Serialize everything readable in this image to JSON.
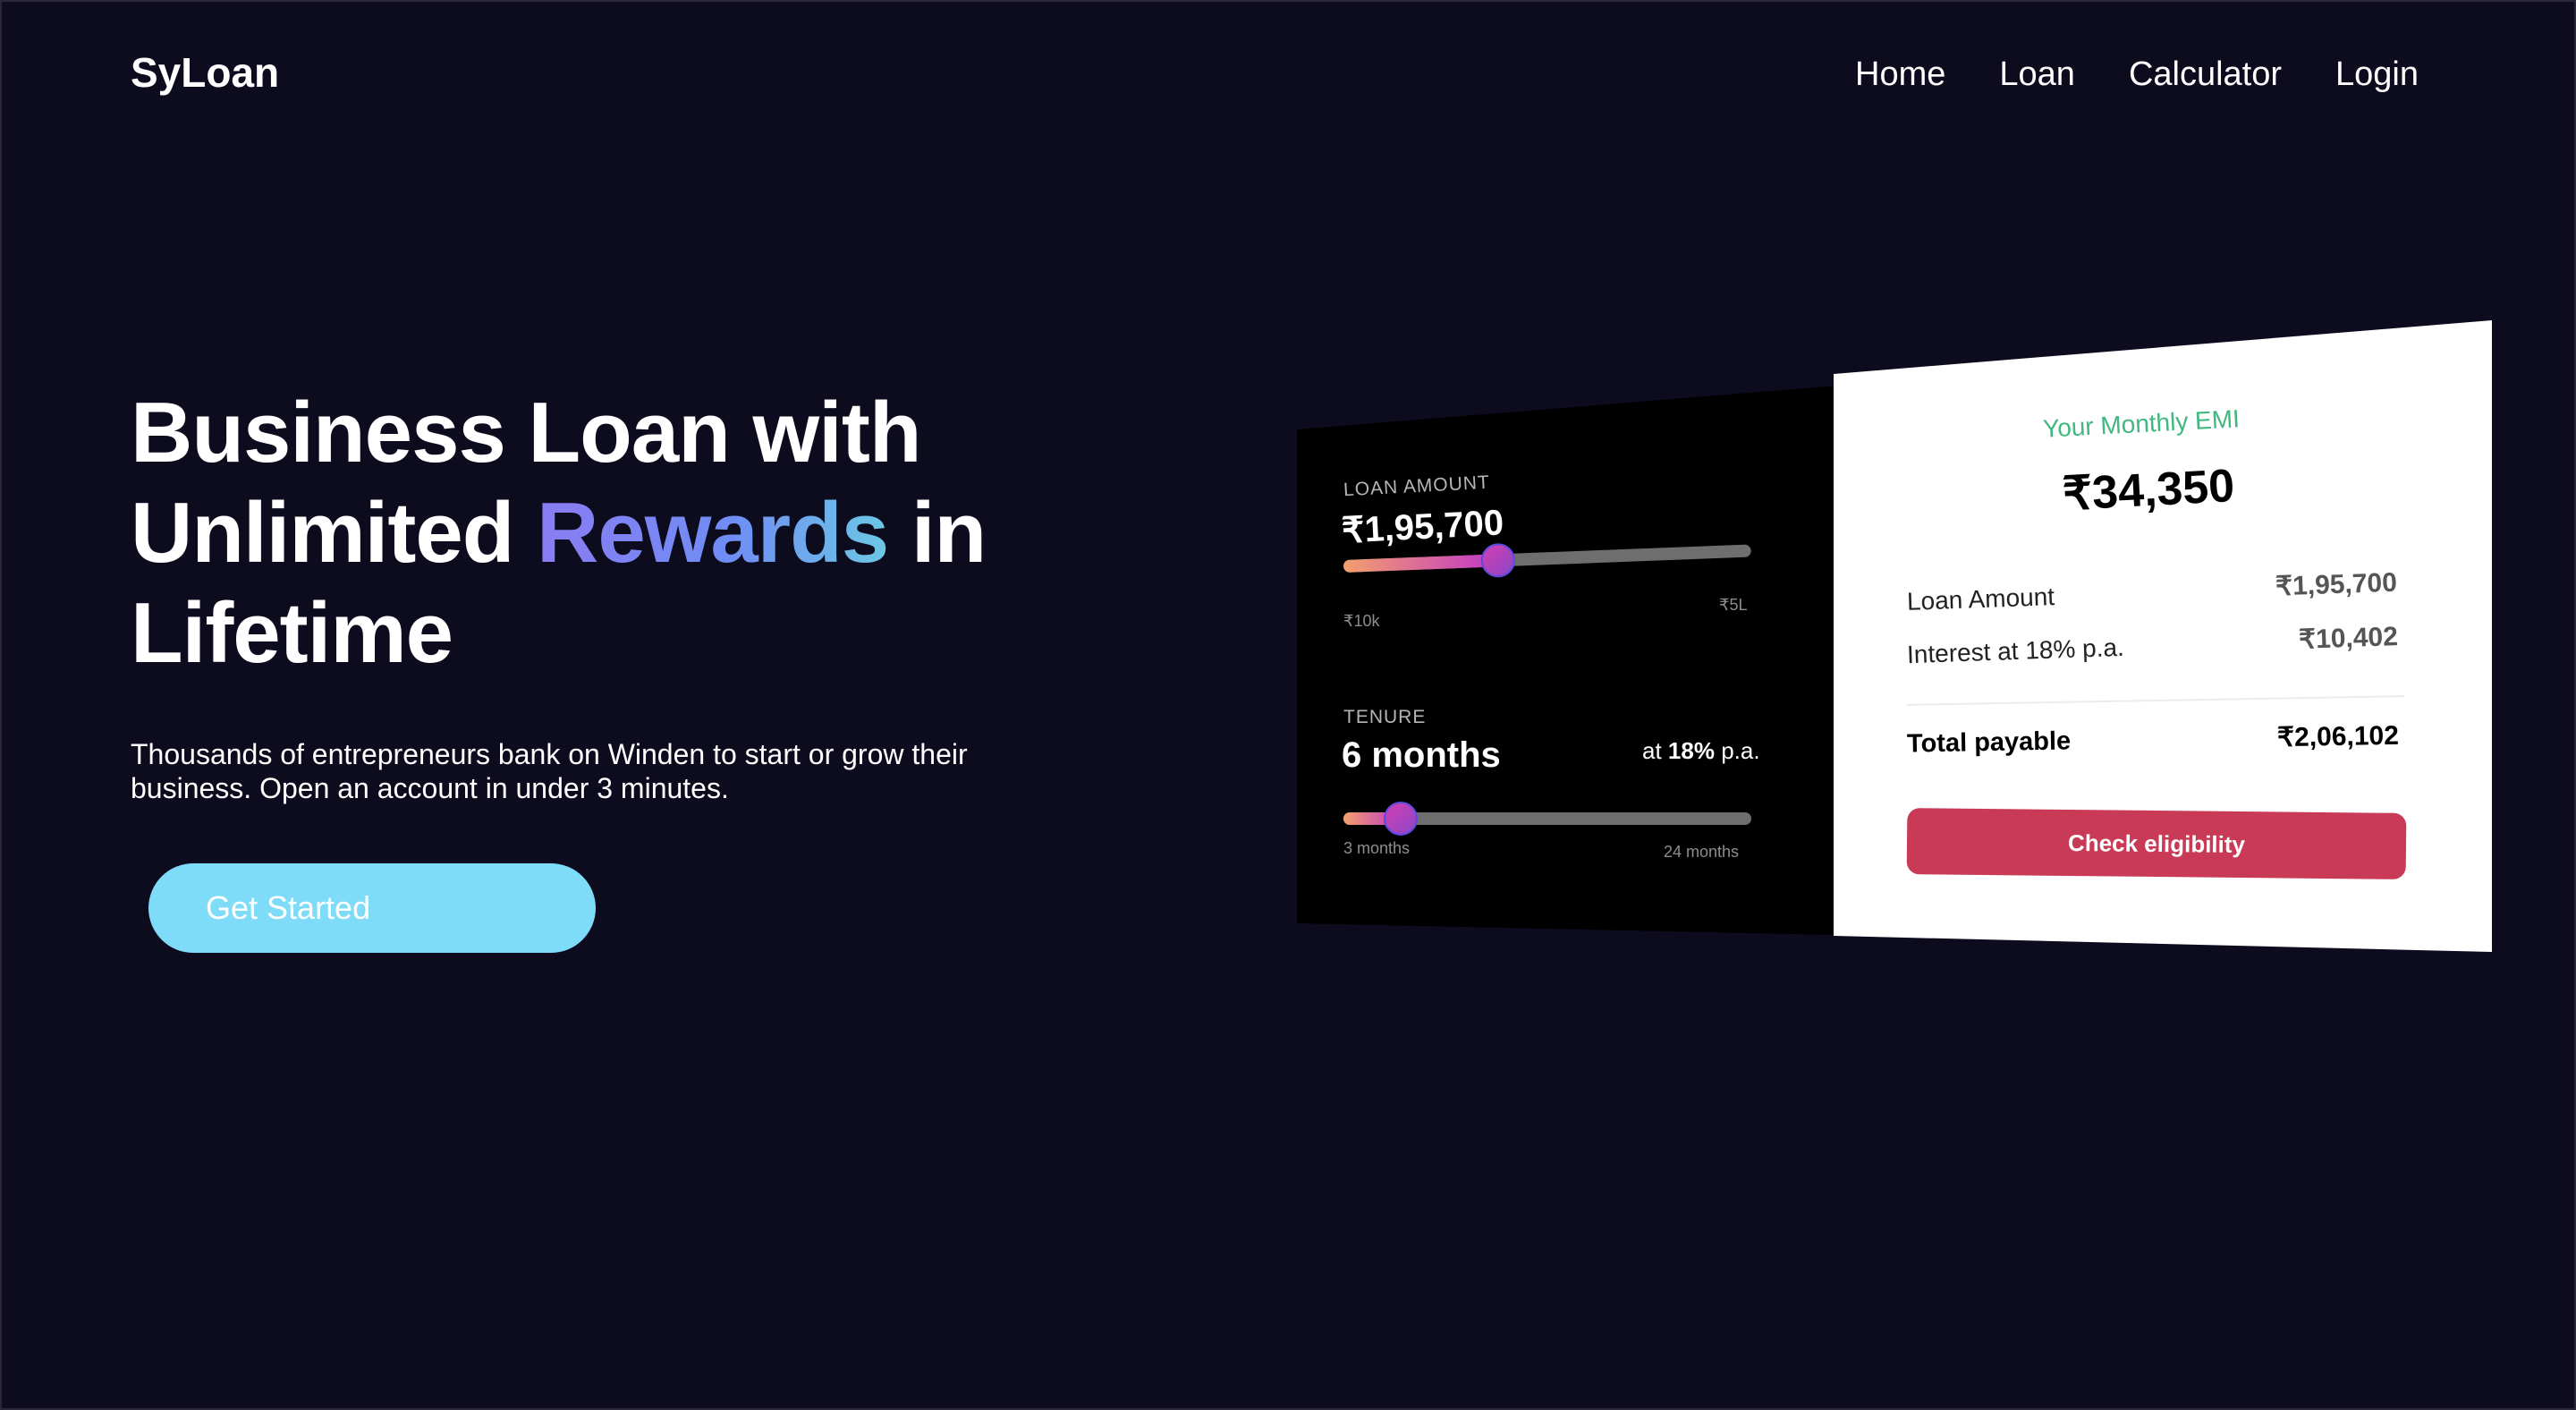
{
  "header": {
    "logo": "SyLoan",
    "nav": [
      "Home",
      "Loan",
      "Calculator",
      "Login"
    ]
  },
  "hero": {
    "title_part1": "Business Loan with Unlimited ",
    "title_highlight": "Rewards",
    "title_part2": " in Lifetime",
    "subtitle": "Thousands of entrepreneurs bank on Winden to start or grow their business. Open an account in under 3 minutes.",
    "cta_label": "Get Started"
  },
  "calculator": {
    "loan_amount": {
      "label": "LOAN AMOUNT",
      "value": "₹1,95,700",
      "min_label": "₹10k",
      "max_label": "₹5L",
      "fraction": 0.38
    },
    "tenure": {
      "label": "TENURE",
      "value": "6 months",
      "rate_prefix": "at ",
      "rate_value": "18%",
      "rate_suffix": " p.a.",
      "min_label": "3 months",
      "max_label": "24 months",
      "fraction": 0.14
    },
    "summary": {
      "emi_label": "Your Monthly EMI",
      "emi_value": "₹34,350",
      "loan_amount_label": "Loan Amount",
      "loan_amount_value": "₹1,95,700",
      "interest_label": "Interest at 18% p.a.",
      "interest_value": "₹10,402",
      "total_label": "Total payable",
      "total_value": "₹2,06,102",
      "button_label": "Check eligibility"
    }
  },
  "colors": {
    "background": "#0d0b1e",
    "accent_cta": "#7fdcf8",
    "check_button": "#c93a56",
    "emi_label": "#41b880"
  }
}
